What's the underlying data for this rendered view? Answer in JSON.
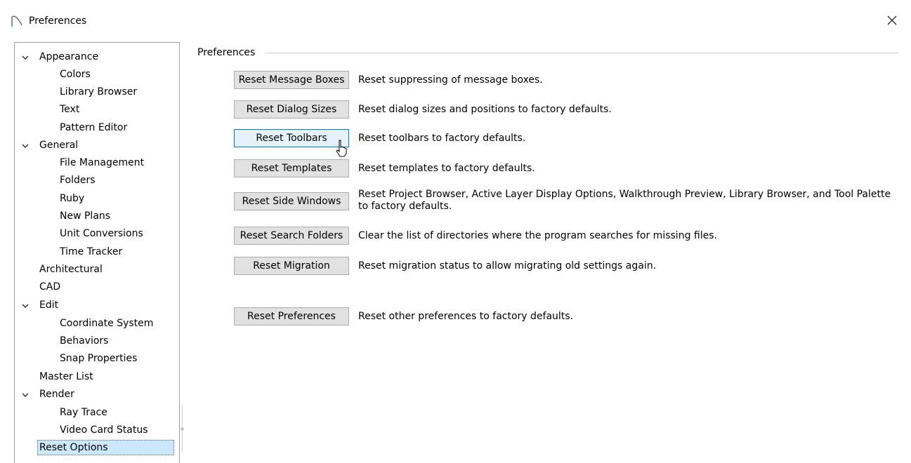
{
  "window": {
    "title": "Preferences"
  },
  "tree": [
    {
      "label": "Appearance",
      "expanded": true,
      "level": 0
    },
    {
      "label": "Colors",
      "level": 1
    },
    {
      "label": "Library Browser",
      "level": 1
    },
    {
      "label": "Text",
      "level": 1
    },
    {
      "label": "Pattern Editor",
      "level": 1
    },
    {
      "label": "General",
      "expanded": true,
      "level": 0
    },
    {
      "label": "File Management",
      "level": 1
    },
    {
      "label": "Folders",
      "level": 1
    },
    {
      "label": "Ruby",
      "level": 1
    },
    {
      "label": "New Plans",
      "level": 1
    },
    {
      "label": "Unit Conversions",
      "level": 1
    },
    {
      "label": "Time Tracker",
      "level": 1
    },
    {
      "label": "Architectural",
      "level": 0
    },
    {
      "label": "CAD",
      "level": 0
    },
    {
      "label": "Edit",
      "expanded": true,
      "level": 0
    },
    {
      "label": "Coordinate System",
      "level": 1
    },
    {
      "label": "Behaviors",
      "level": 1
    },
    {
      "label": "Snap Properties",
      "level": 1
    },
    {
      "label": "Master List",
      "level": 0
    },
    {
      "label": "Render",
      "expanded": true,
      "level": 0
    },
    {
      "label": "Ray Trace",
      "level": 1
    },
    {
      "label": "Video Card Status",
      "level": 1
    },
    {
      "label": "Reset Options",
      "level": 0,
      "selected": true
    }
  ],
  "group": {
    "label": "Preferences"
  },
  "actions": [
    {
      "button": "Reset Message Boxes",
      "description": "Reset suppressing of message boxes."
    },
    {
      "button": "Reset Dialog Sizes",
      "description": "Reset dialog sizes and positions to factory defaults."
    },
    {
      "button": "Reset Toolbars",
      "description": "Reset toolbars to factory defaults.",
      "hovered": true
    },
    {
      "button": "Reset Templates",
      "description": "Reset templates to factory defaults."
    },
    {
      "button": "Reset Side Windows",
      "description": "Reset Project Browser, Active Layer Display Options, Walkthrough Preview, Library Browser, and Tool Palette to factory defaults."
    },
    {
      "button": "Reset Search Folders",
      "description": "Clear the list of directories where the program searches for missing files."
    },
    {
      "button": "Reset Migration",
      "description": "Reset migration status to allow migrating old settings again."
    },
    {
      "button": "Reset Preferences",
      "description": "Reset other preferences to factory defaults."
    }
  ],
  "colors": {
    "selection": "#cce8ff",
    "hover_border": "#0078d7",
    "button_face": "#e1e1e1"
  }
}
